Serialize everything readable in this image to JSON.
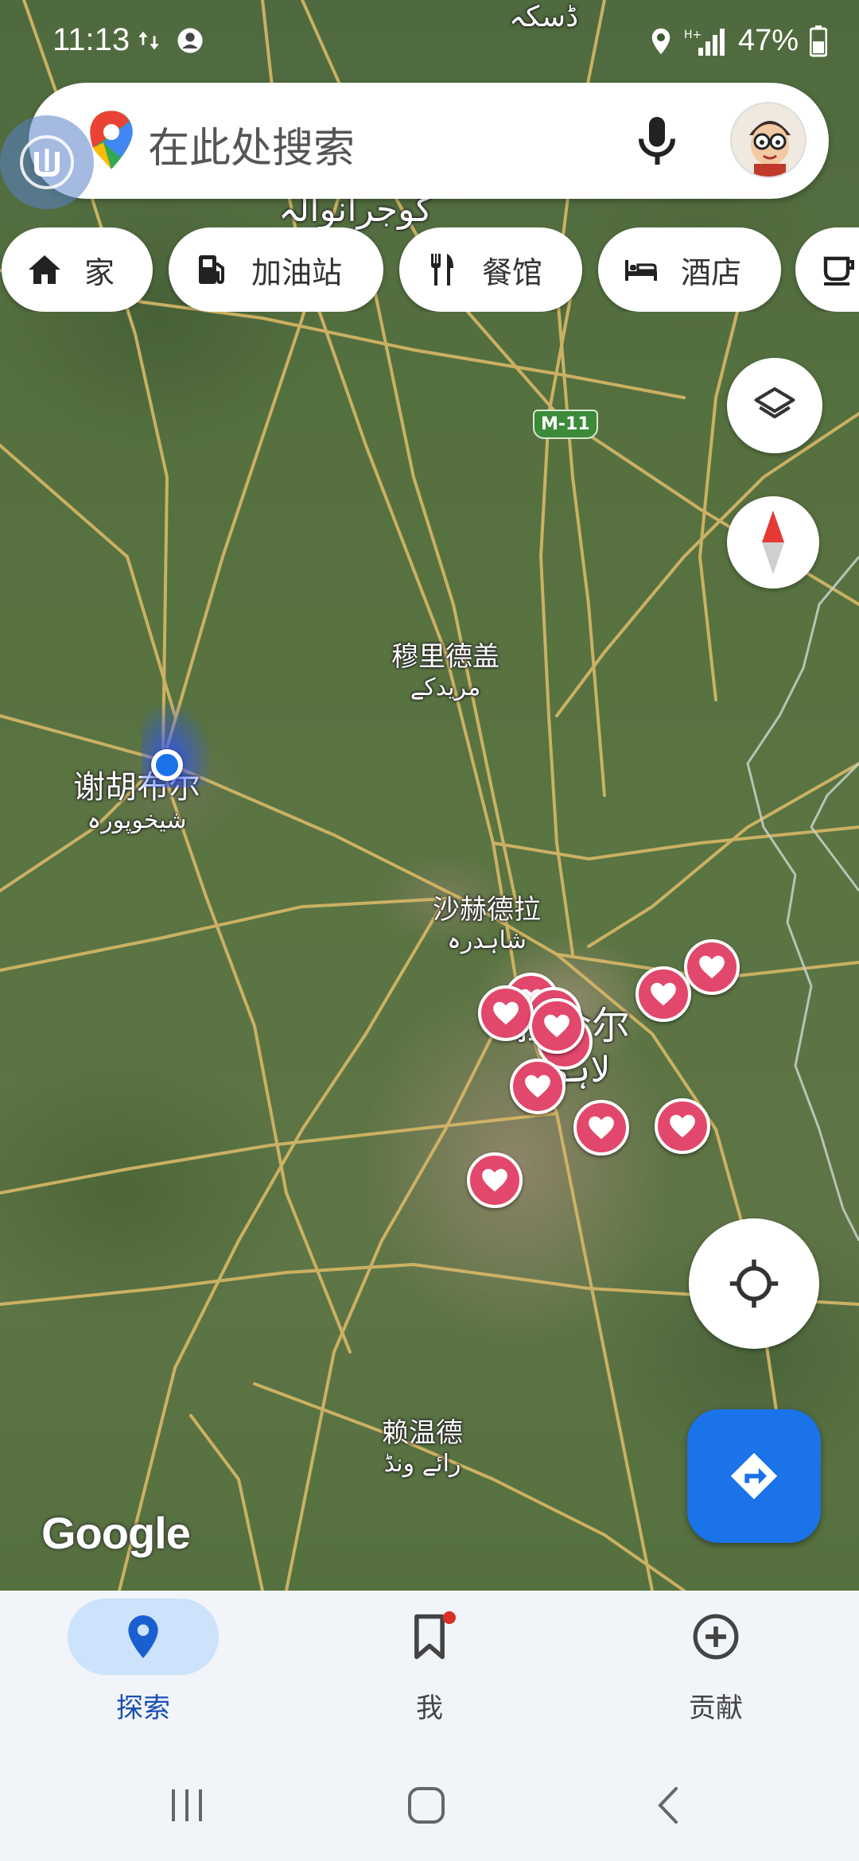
{
  "status_bar": {
    "time": "11:13",
    "battery": "47%",
    "icons_left": [
      "data-transfer-icon",
      "account-circle-icon"
    ],
    "icons_right": [
      "location-icon",
      "signal-icon",
      "battery-icon"
    ]
  },
  "search": {
    "placeholder": "在此处搜索",
    "icons": [
      "google-maps-logo-icon",
      "mic-icon",
      "avatar"
    ]
  },
  "chips": [
    {
      "label": "家",
      "icon": "home-icon"
    },
    {
      "label": "加油站",
      "icon": "gas-station-icon"
    },
    {
      "label": "餐馆",
      "icon": "restaurant-icon"
    },
    {
      "label": "酒店",
      "icon": "hotel-icon"
    },
    {
      "label": "",
      "icon": "coffee-icon"
    }
  ],
  "map": {
    "labels": [
      {
        "name": "谢胡布尔",
        "sub": "شیخوپورہ"
      },
      {
        "name": "穆里德盖",
        "sub": "مریدکے"
      },
      {
        "name": "沙赫德拉",
        "sub": "شاہدرہ"
      },
      {
        "name": "拉合尔",
        "sub": "لاہور"
      },
      {
        "name": "赖温德",
        "sub": "رائے ونڈ"
      }
    ],
    "top_labels": [
      "ڈسکہ",
      "گوجرانوالہ"
    ],
    "highway_shield": "M-11",
    "watermark": "Google",
    "saved_pin_count": 11,
    "colors": {
      "pin": "#e2486c",
      "location_dot": "#1a73e8"
    }
  },
  "map_controls": [
    "layers-icon",
    "compass-icon",
    "my-location-icon",
    "directions-icon"
  ],
  "bottom_nav": [
    {
      "label": "探索",
      "icon": "explore-pin-icon",
      "active": true
    },
    {
      "label": "我",
      "icon": "bookmark-icon",
      "active": false,
      "badge": true
    },
    {
      "label": "贡献",
      "icon": "add-circle-icon",
      "active": false
    }
  ],
  "system_nav": [
    "recent-apps-icon",
    "home-button-icon",
    "back-icon"
  ]
}
